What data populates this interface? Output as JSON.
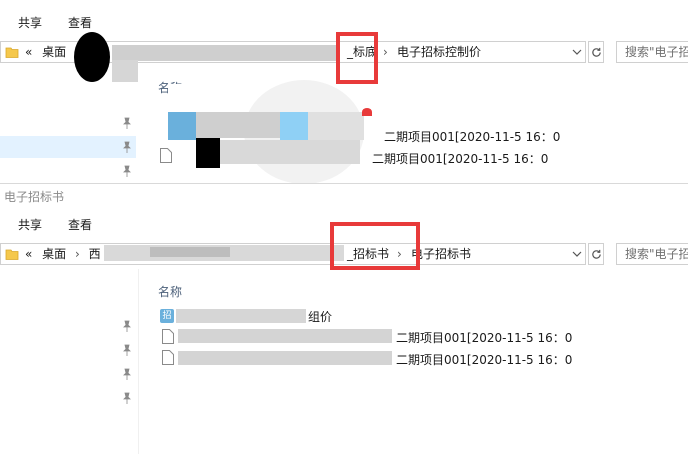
{
  "window_top": {
    "ribbon": {
      "tab_share": "共享",
      "tab_view": "查看"
    },
    "address": {
      "overflow": "«",
      "crumb_desktop": "桌面",
      "crumb_current": "_标底",
      "crumb_child": "电子招标控制价"
    },
    "search_placeholder": "搜索\"电子招",
    "column_name": "名称",
    "files": [
      {
        "name": "二期项目001[2020-11-5 16：0"
      },
      {
        "name": "二期项目001[2020-11-5 16：0"
      }
    ]
  },
  "window_bottom": {
    "title": "电子招标书",
    "ribbon": {
      "tab_share": "共享",
      "tab_view": "查看"
    },
    "address": {
      "overflow": "«",
      "crumb_desktop": "桌面",
      "crumb_partial": "西",
      "crumb_current": "_招标书",
      "crumb_child": "电子招标书"
    },
    "search_placeholder": "搜索\"电子招",
    "column_name": "名称",
    "files": [
      {
        "name": "组价",
        "icon": "folder-zip-icon"
      },
      {
        "name": "二期项目001[2020-11-5 16：0",
        "icon": "document-icon"
      },
      {
        "name": "二期项目001[2020-11-5 16：0",
        "icon": "document-icon"
      }
    ]
  },
  "colors": {
    "highlight": "#e83a3a",
    "selection": "#cce8ff",
    "header_text": "#4c607a"
  }
}
